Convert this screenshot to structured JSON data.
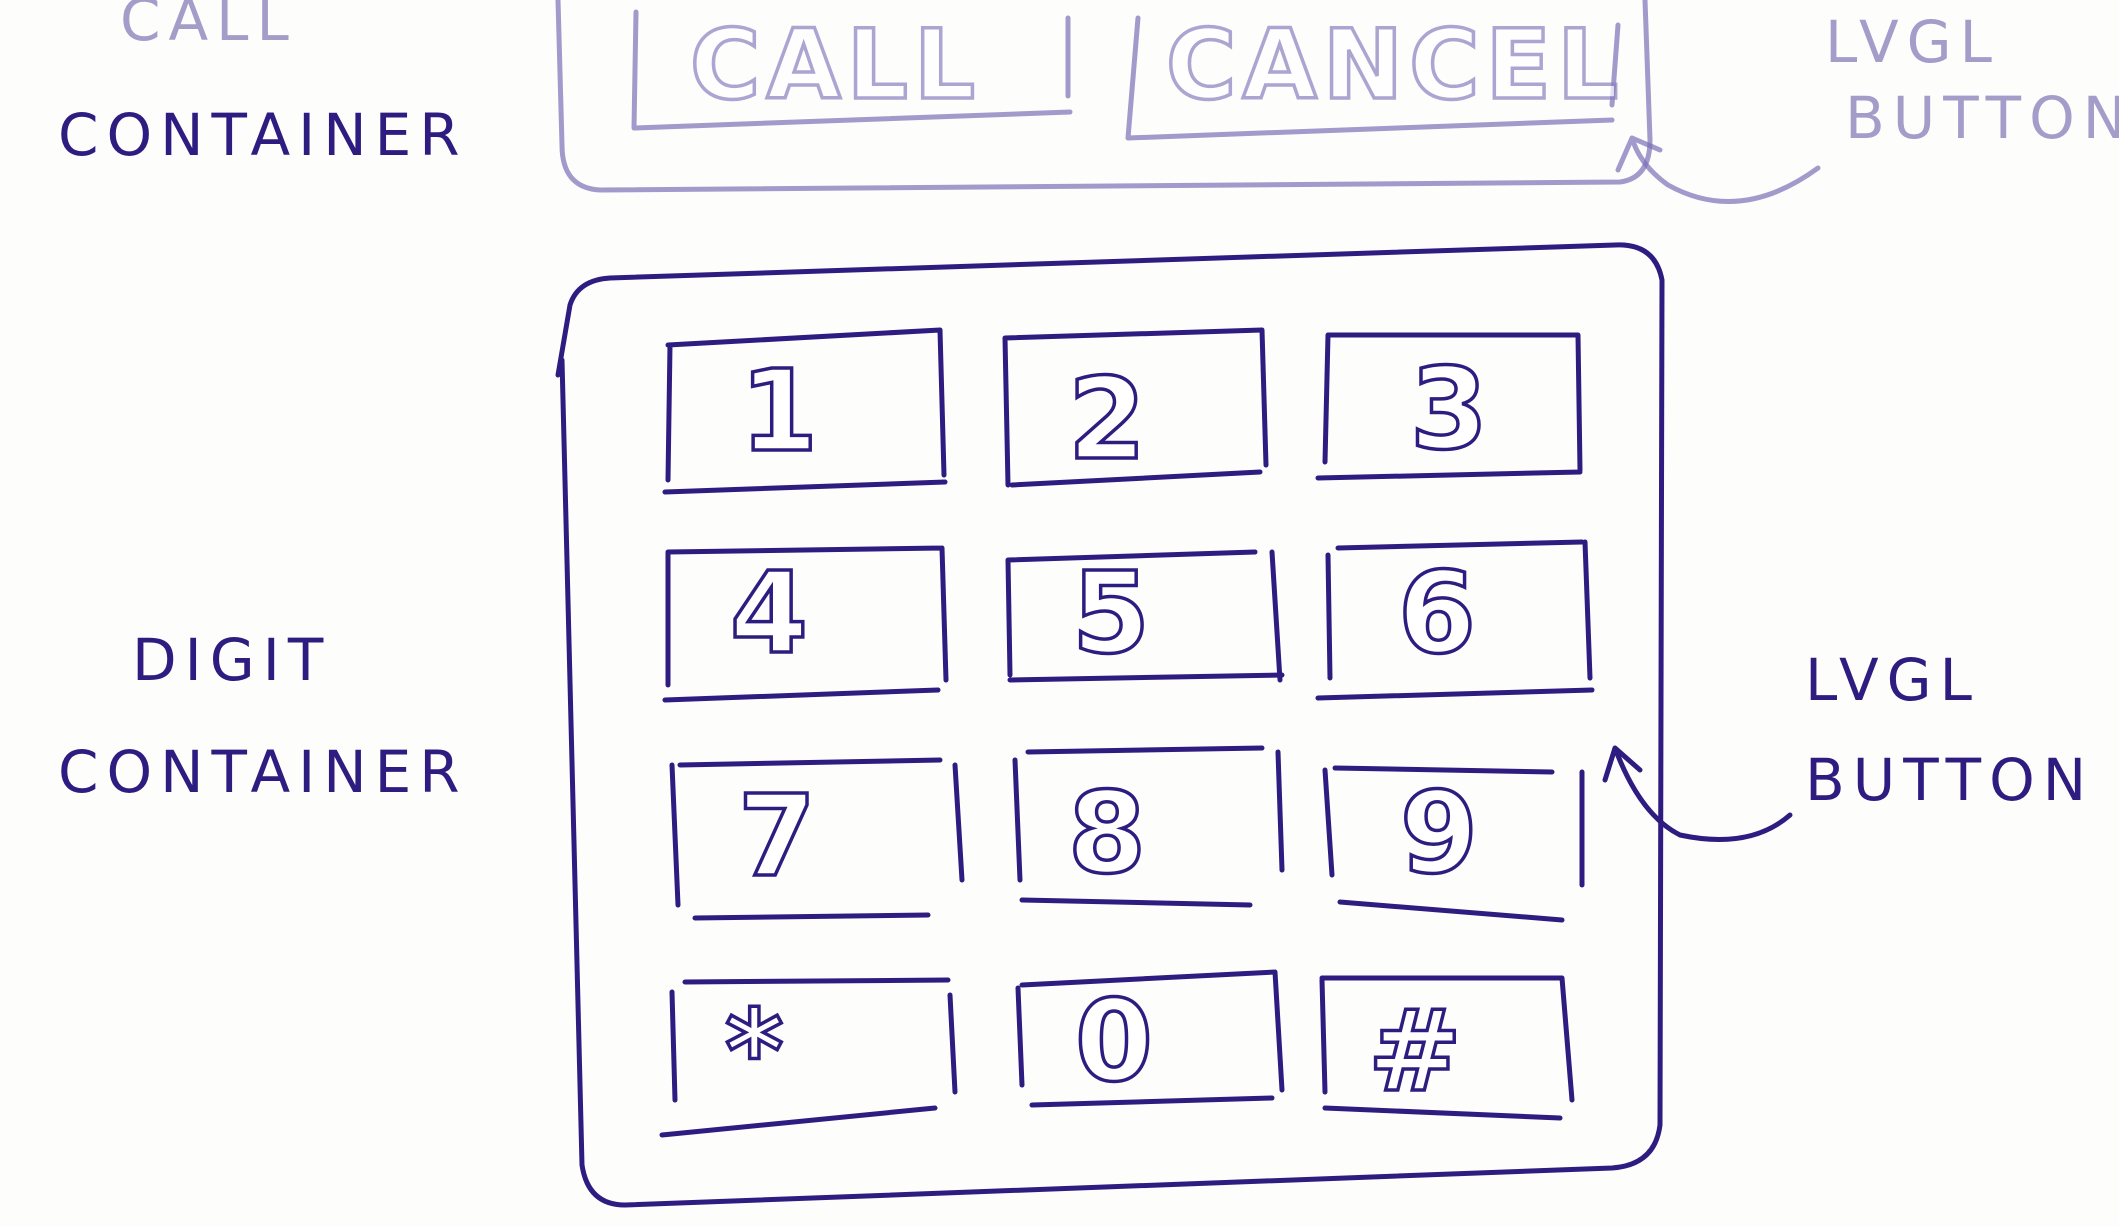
{
  "labels": {
    "call_container": [
      "CALL",
      "CONTAINER"
    ],
    "lvgl_button_top": [
      "LVGL",
      "BUTTON"
    ],
    "digit_container": [
      "DIGIT",
      "CONTAINER"
    ],
    "lvgl_button_right": [
      "LVGL",
      "BUTTON"
    ]
  },
  "call_buttons": [
    "CALL",
    "CANCEL"
  ],
  "keypad_keys": [
    "1",
    "2",
    "3",
    "4",
    "5",
    "6",
    "7",
    "8",
    "9",
    "*",
    "0",
    "#"
  ],
  "colors": {
    "ink": "#2e1c80",
    "faded_ink": "#7a6fb6",
    "paper": "#fdfdfc"
  }
}
